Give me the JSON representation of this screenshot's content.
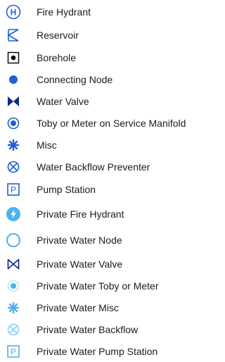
{
  "legend": {
    "items": [
      {
        "label": "Fire Hydrant",
        "icon": "fire-hydrant-icon"
      },
      {
        "label": "Reservoir",
        "icon": "reservoir-icon"
      },
      {
        "label": "Borehole",
        "icon": "borehole-icon"
      },
      {
        "label": "Connecting Node",
        "icon": "connecting-node-icon"
      },
      {
        "label": "Water Valve",
        "icon": "water-valve-icon"
      },
      {
        "label": "Toby or Meter on Service Manifold",
        "icon": "toby-meter-icon"
      },
      {
        "label": "Misc",
        "icon": "misc-icon"
      },
      {
        "label": "Water Backflow Preventer",
        "icon": "backflow-preventer-icon"
      },
      {
        "label": "Pump Station",
        "icon": "pump-station-icon"
      },
      {
        "label": "Private Fire Hydrant",
        "icon": "private-fire-hydrant-icon"
      },
      {
        "label": "Private Water Node",
        "icon": "private-water-node-icon"
      },
      {
        "label": "Private Water Valve",
        "icon": "private-water-valve-icon"
      },
      {
        "label": "Private Water Toby or Meter",
        "icon": "private-toby-meter-icon"
      },
      {
        "label": "Private Water Misc",
        "icon": "private-misc-icon"
      },
      {
        "label": "Private Water Backflow",
        "icon": "private-backflow-icon"
      },
      {
        "label": "Private Water Pump Station",
        "icon": "private-pump-station-icon"
      }
    ]
  },
  "colors": {
    "public": "#1f5fd6",
    "private": "#4ab3f0",
    "black": "#000000",
    "text": "#1b1b1b"
  }
}
